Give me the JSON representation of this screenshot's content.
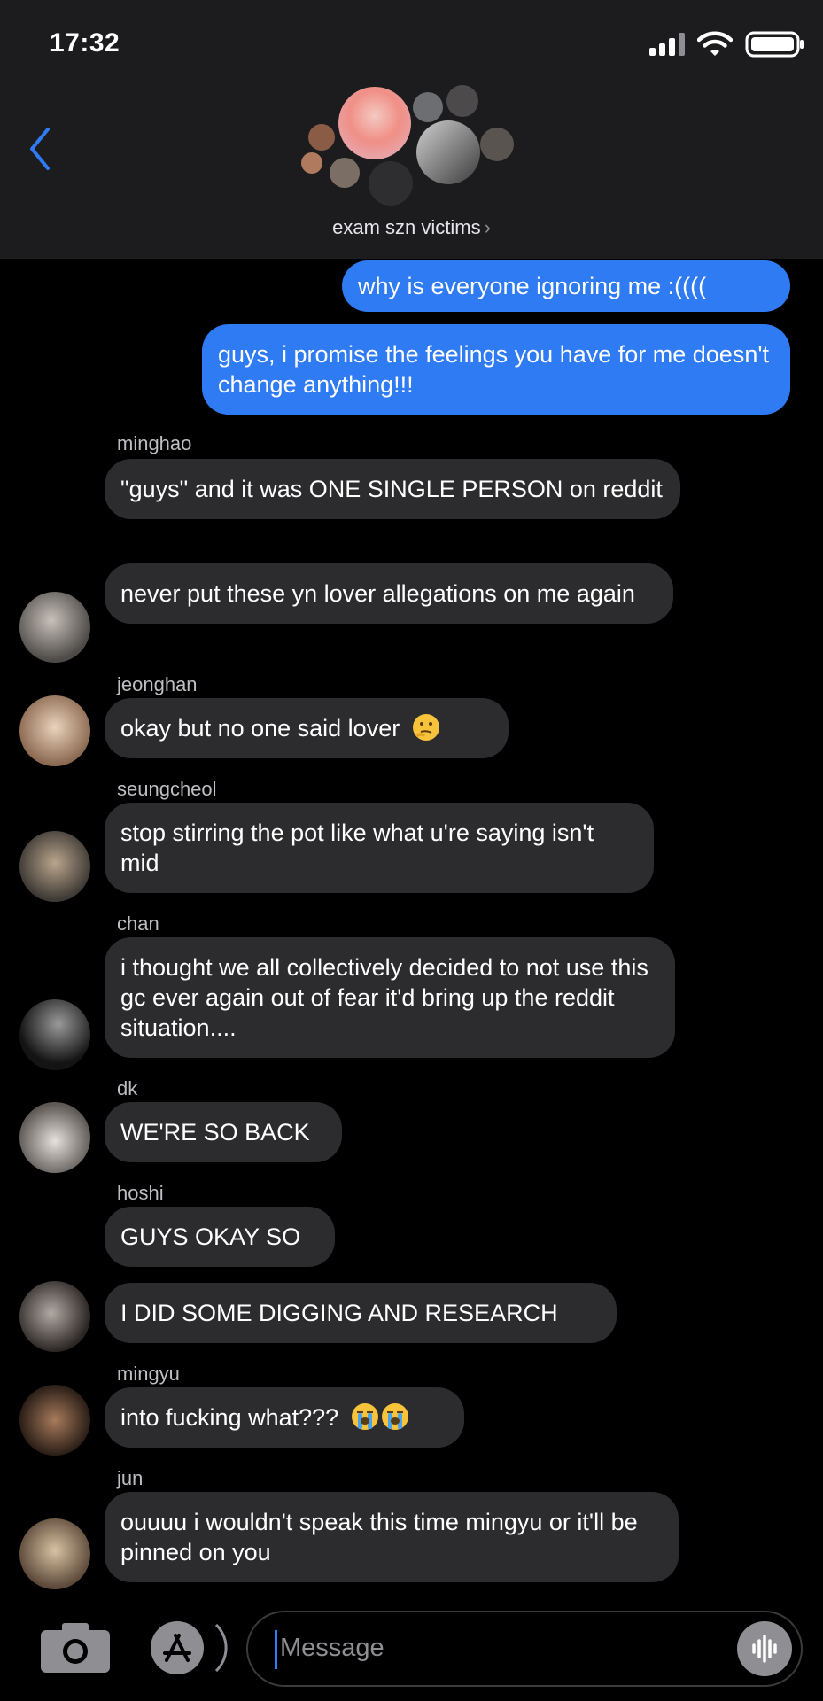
{
  "status_bar": {
    "time": "17:32"
  },
  "header": {
    "group_name": "exam szn victims",
    "chevron": "›"
  },
  "messages": {
    "m1": "why is everyone ignoring me :((((",
    "m2": "guys, i promise the feelings you have for me doesn't change anything!!!",
    "m3_sender": "minghao",
    "m3": "\"guys\" and it was ONE SINGLE PERSON on reddit",
    "m4": "never put these yn lover allegations on me again",
    "m5_sender": "jeonghan",
    "m5": "okay but no one said lover",
    "m6_sender": "seungcheol",
    "m6": "stop stirring the pot like what u're saying isn't mid",
    "m7_sender": "chan",
    "m7": "i thought we all collectively decided to not use this gc ever again out of fear it'd bring up the reddit situation....",
    "m8_sender": "dk",
    "m8": "WE'RE SO BACK",
    "m9_sender": "hoshi",
    "m9": "GUYS OKAY SO",
    "m10": "I DID SOME DIGGING AND RESEARCH",
    "m11_sender": "mingyu",
    "m11": "into fucking what???",
    "m12_sender": "jun",
    "m12": "ouuuu i wouldn't speak this time mingyu or it'll be pinned on you"
  },
  "input": {
    "placeholder": "Message"
  },
  "icons": {
    "thinking": "thinking-face-emoji",
    "crying": "loudly-crying-face-emoji"
  },
  "colors": {
    "sent_bubble": "#2f7bf4",
    "received_bubble": "#2c2c2e",
    "header_bg": "#1c1c1e"
  }
}
